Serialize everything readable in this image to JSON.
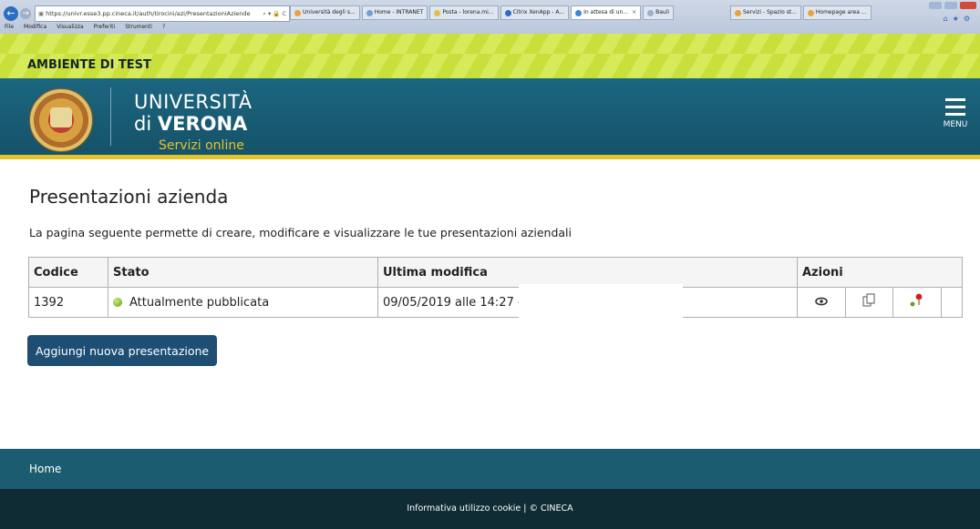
{
  "browser": {
    "url": "https://univr.esse3.pp.cineca.it/auth/tirocini/azi/PresentazioniAziende",
    "tabs": [
      {
        "label": "Università degli s...",
        "active": false
      },
      {
        "label": "Home - INTRANET",
        "active": false
      },
      {
        "label": "Posta - lorena.mi...",
        "active": false
      },
      {
        "label": "Citrix XenApp - A...",
        "active": false
      },
      {
        "label": "In attesa di un...",
        "active": true
      },
      {
        "label": "Bauli",
        "active": false
      },
      {
        "label": "Servizi - Spazio st...",
        "active": false
      },
      {
        "label": "Homepage area ...",
        "active": false
      }
    ],
    "menu": [
      "File",
      "Modifica",
      "Visualizza",
      "Preferiti",
      "Strumenti",
      "?"
    ]
  },
  "banner": {
    "text": "AMBIENTE DI TEST"
  },
  "header": {
    "line1": "UNIVERSITÀ",
    "line2_prefix": "di",
    "line2_bold": "VERONA",
    "subtitle": "Servizi online",
    "menu_label": "MENU"
  },
  "page": {
    "title": "Presentazioni azienda",
    "description": "La pagina seguente permette di creare, modificare e visualizzare le tue presentazioni aziendali"
  },
  "table": {
    "headers": {
      "code": "Codice",
      "status": "Stato",
      "modified": "Ultima modifica",
      "actions": "Azioni"
    },
    "rows": [
      {
        "code": "1392",
        "status": "Attualmente pubblicata",
        "modified": "09/05/2019 alle 14:27 -"
      }
    ]
  },
  "add_button": {
    "label": "Aggiungi nuova presentazione"
  },
  "footer": {
    "home": "Home",
    "cookie": "Informativa utilizzo cookie | © CINECA"
  },
  "colors": {
    "header": "#1c6680",
    "accent": "#e2c32a",
    "button": "#1e4e73",
    "status": "#5a9f1e"
  }
}
